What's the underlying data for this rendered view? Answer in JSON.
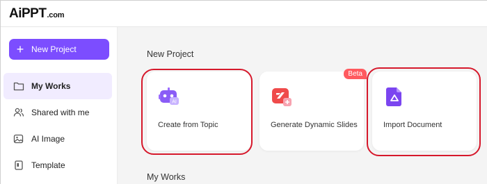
{
  "app": {
    "logo_big": "AiPPT",
    "logo_small": ".com"
  },
  "sidebar": {
    "new_project_label": "New Project",
    "items": [
      {
        "label": "My Works",
        "icon": "folder-icon",
        "active": true
      },
      {
        "label": "Shared with me",
        "icon": "users-icon",
        "active": false
      },
      {
        "label": "AI Image",
        "icon": "image-icon",
        "active": false
      },
      {
        "label": "Template",
        "icon": "template-icon",
        "active": false
      }
    ]
  },
  "main": {
    "new_project_title": "New Project",
    "my_works_title": "My Works",
    "cards": [
      {
        "label": "Create from Topic",
        "icon": "robot-icon",
        "badge": ""
      },
      {
        "label": "Generate Dynamic Slides",
        "icon": "dynamic-slides-icon",
        "badge": "Beta"
      },
      {
        "label": "Import Document",
        "icon": "document-icon",
        "badge": ""
      }
    ]
  },
  "colors": {
    "accent": "#7c4dff",
    "active_bg": "#f1ecff",
    "highlight": "#d6182b",
    "beta": "#ff5a5f"
  }
}
